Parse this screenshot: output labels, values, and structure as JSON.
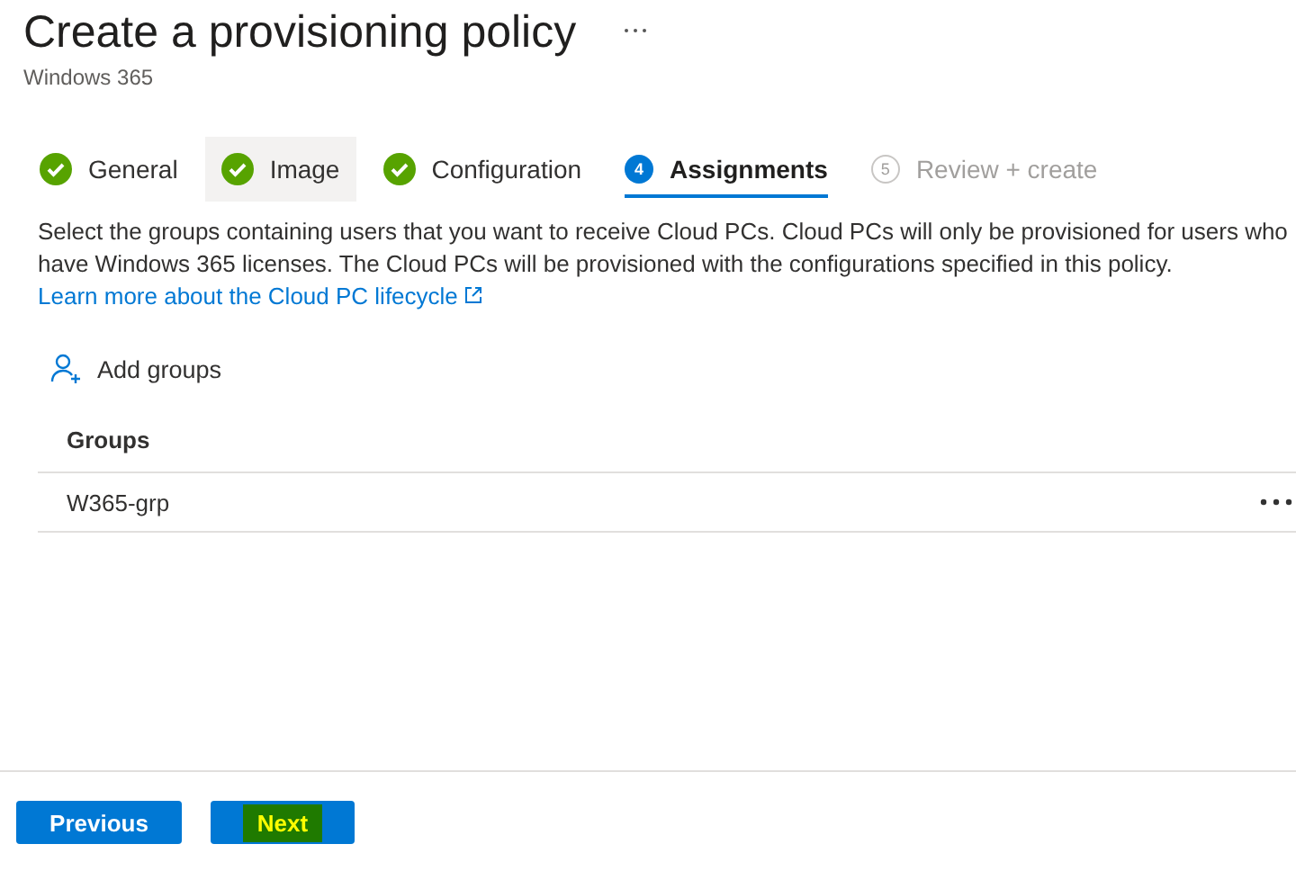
{
  "header": {
    "title": "Create a provisioning policy",
    "subtitle": "Windows 365"
  },
  "steps": [
    {
      "label": "General",
      "kind": "done",
      "selected": false,
      "hovered": false
    },
    {
      "label": "Image",
      "kind": "done",
      "selected": false,
      "hovered": true
    },
    {
      "label": "Configuration",
      "kind": "done",
      "selected": false,
      "hovered": false
    },
    {
      "label": "Assignments",
      "kind": "current",
      "number": "4",
      "selected": true,
      "hovered": false
    },
    {
      "label": "Review + create",
      "kind": "pending",
      "number": "5",
      "selected": false,
      "hovered": false
    }
  ],
  "description": {
    "text": "Select the groups containing users that you want to receive Cloud PCs. Cloud PCs will only be provisioned for users who have Windows 365 licenses. The Cloud PCs will be provisioned with the configurations specified in this policy.",
    "link": "Learn more about the Cloud PC lifecycle"
  },
  "add_groups": "Add groups",
  "table": {
    "columns": [
      "Groups"
    ],
    "rows": [
      {
        "name": "W365-grp"
      }
    ]
  },
  "footer": {
    "buttons": [
      {
        "label": "Previous",
        "highlighted": false
      },
      {
        "label": "Next",
        "highlighted": true
      }
    ]
  }
}
